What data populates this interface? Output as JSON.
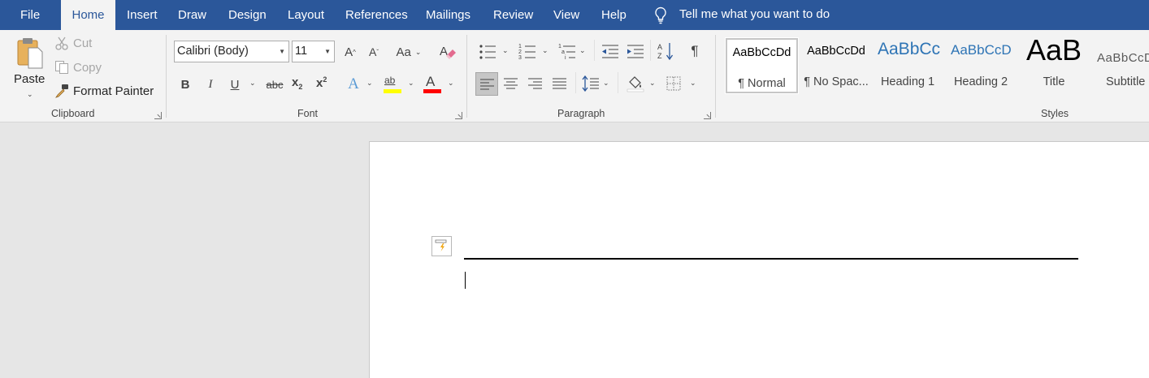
{
  "menubar": {
    "tabs": [
      {
        "label": "File"
      },
      {
        "label": "Home"
      },
      {
        "label": "Insert"
      },
      {
        "label": "Draw"
      },
      {
        "label": "Design"
      },
      {
        "label": "Layout"
      },
      {
        "label": "References"
      },
      {
        "label": "Mailings"
      },
      {
        "label": "Review"
      },
      {
        "label": "View"
      },
      {
        "label": "Help"
      }
    ],
    "active_tab": "Home",
    "tell_me": "Tell me what you want to do"
  },
  "clipboard": {
    "label": "Clipboard",
    "paste": "Paste",
    "cut": "Cut",
    "copy": "Copy",
    "format_painter": "Format Painter"
  },
  "font": {
    "label": "Font",
    "font_name": "Calibri (Body)",
    "font_size": "11",
    "change_case": "Aa",
    "bold": "B",
    "italic": "I",
    "underline": "U",
    "strikethrough": "abc",
    "subscript": "x",
    "subscript_mark": "2",
    "superscript": "x",
    "superscript_mark": "2",
    "text_effects": "A",
    "highlight": "ab",
    "font_color": "A",
    "highlight_color": "#ffff00",
    "font_color_value": "#ff0000"
  },
  "paragraph": {
    "label": "Paragraph",
    "pilcrow": "¶"
  },
  "styles": {
    "label": "Styles",
    "items": [
      {
        "preview": "AaBbCcDd",
        "name": "¶ Normal",
        "selected": true
      },
      {
        "preview": "AaBbCcDd",
        "name": "¶ No Spac..."
      },
      {
        "preview": "AaBbCc",
        "name": "Heading 1"
      },
      {
        "preview": "AaBbCcD",
        "name": "Heading 2"
      },
      {
        "preview": "AaB",
        "name": "Title"
      },
      {
        "preview": "AaBbCcD",
        "name": "Subtitle"
      }
    ]
  },
  "colors": {
    "accent": "#2b579a",
    "ribbon_bg": "#f3f3f3",
    "canvas_bg": "#e6e6e6"
  }
}
